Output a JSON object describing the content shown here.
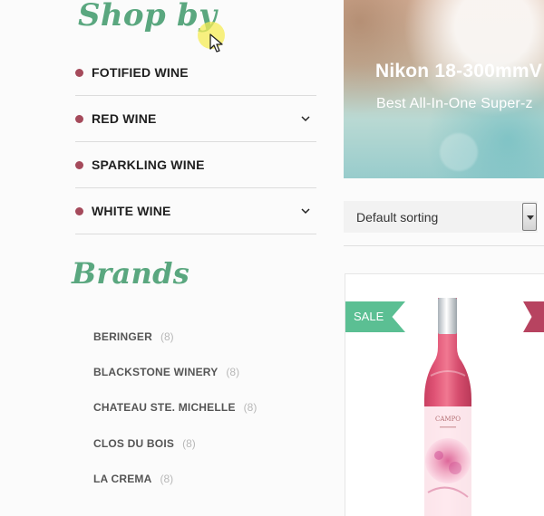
{
  "sidebar": {
    "shop_title": "Shop by",
    "categories": [
      {
        "label": "FOTIFIED WINE",
        "has_submenu": false
      },
      {
        "label": "RED WINE",
        "has_submenu": true
      },
      {
        "label": "SPARKLING WINE",
        "has_submenu": false
      },
      {
        "label": "WHITE WINE",
        "has_submenu": true
      }
    ],
    "brands_title": "Brands",
    "brands": [
      {
        "name": "BERINGER",
        "count": "(8)"
      },
      {
        "name": "BLACKSTONE WINERY",
        "count": "(8)"
      },
      {
        "name": "CHATEAU STE. MICHELLE",
        "count": "(8)"
      },
      {
        "name": "CLOS DU BOIS",
        "count": "(8)"
      },
      {
        "name": "LA CREMA",
        "count": "(8)"
      }
    ]
  },
  "banner": {
    "title": "Nikon 18-300mmV",
    "subtitle": "Best All-In-One Super-z"
  },
  "sorting": {
    "selected": "Default sorting"
  },
  "product": {
    "badge": "SALE",
    "label_text": "CAMPO"
  },
  "colors": {
    "accent_green": "#5aa77f",
    "bullet": "#a54a5b",
    "sale_ribbon": "#5bbf93",
    "wine_rose": "#d94f6f"
  },
  "icons": {
    "cursor": "pointer-cursor",
    "category_bullet": "dot",
    "submenu_toggle": "chevron-down"
  }
}
